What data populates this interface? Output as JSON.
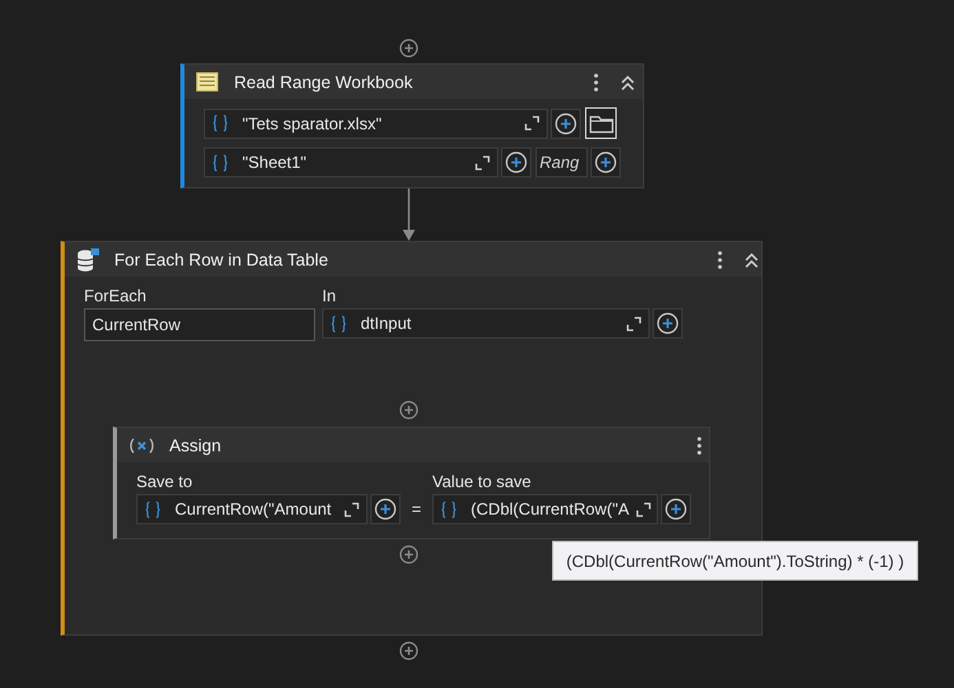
{
  "read_range": {
    "title": "Read Range Workbook",
    "workbook": "\"Tets sparator.xlsx\"",
    "sheet": "\"Sheet1\"",
    "range": {
      "placeholder": "Rang"
    }
  },
  "for_each": {
    "title": "For Each Row in Data Table",
    "foreach_label": "ForEach",
    "foreach_value": "CurrentRow",
    "in_label": "In",
    "in_value": "dtInput"
  },
  "assign": {
    "title": "Assign",
    "save_to_label": "Save to",
    "save_to_value": "CurrentRow(\"Amount",
    "equals": "=",
    "value_label": "Value to save",
    "value": "(CDbl(CurrentRow(\"A"
  },
  "tooltip": "(CDbl(CurrentRow(\"Amount\").ToString) * (-1) )"
}
